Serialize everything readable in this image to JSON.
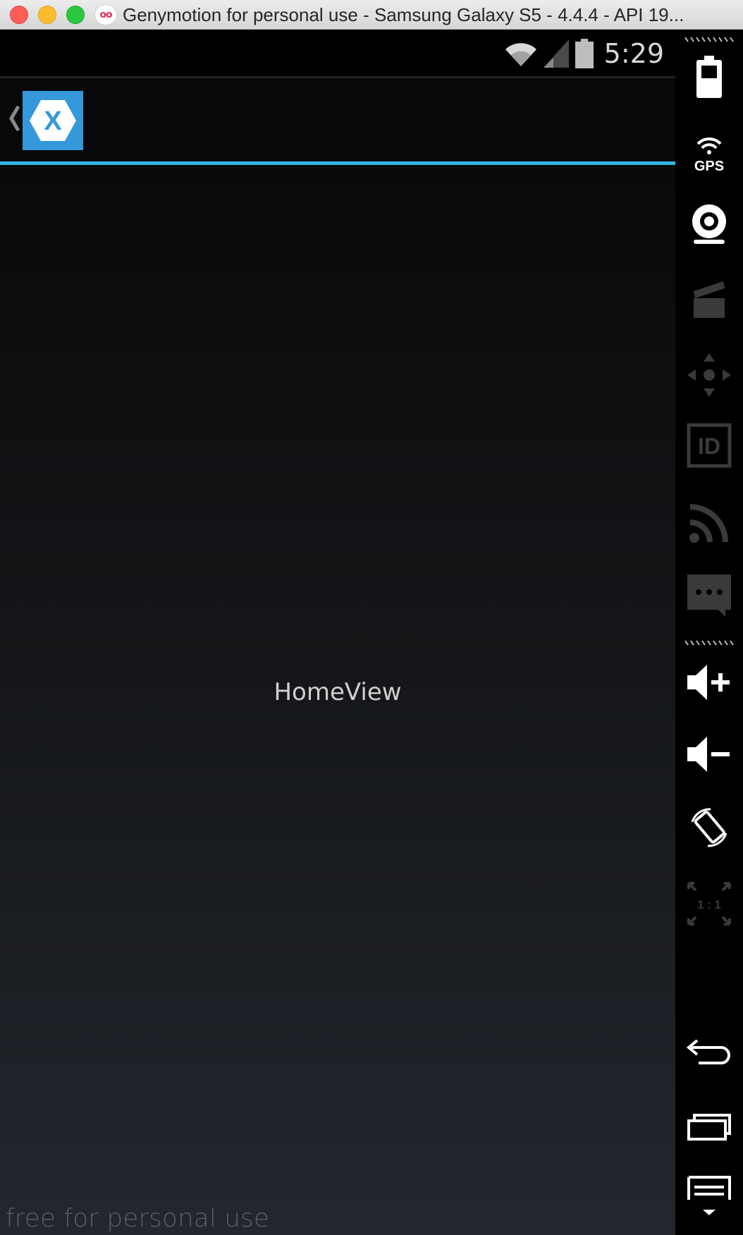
{
  "window": {
    "title": "Genymotion for personal use - Samsung Galaxy S5 - 4.4.4 - API 19...",
    "app_icon_glyph": "oo"
  },
  "statusbar": {
    "time": "5:29",
    "icons": [
      "wifi-icon",
      "signal-icon",
      "battery-icon"
    ]
  },
  "actionbar": {
    "logo": "xamarin-logo-icon",
    "logo_letter": "X",
    "accent_color": "#33b5e5",
    "logo_color": "#3498db"
  },
  "content": {
    "label": "HomeView"
  },
  "watermark": "free for personal use",
  "sidebar": {
    "gps_label": "GPS",
    "id_label": "ID",
    "pixel_ratio_label": "1 : 1",
    "tools": [
      "battery-widget-icon",
      "gps-widget-icon",
      "webcam-widget-icon",
      "capture-widget-icon",
      "remote-control-widget-icon",
      "device-id-widget-icon",
      "network-widget-icon",
      "sms-widget-icon",
      "volume-up-icon",
      "volume-down-icon",
      "rotate-icon",
      "pixel-perfect-icon",
      "back-icon",
      "recent-apps-icon",
      "menu-icon"
    ]
  }
}
